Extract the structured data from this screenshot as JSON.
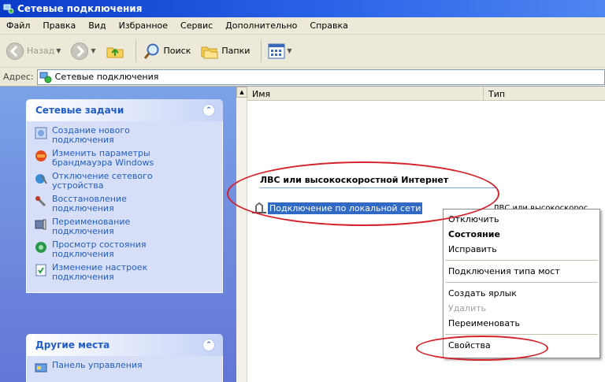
{
  "window": {
    "title": "Сетевые подключения"
  },
  "menu": [
    "Файл",
    "Правка",
    "Вид",
    "Избранное",
    "Сервис",
    "Дополнительно",
    "Справка"
  ],
  "toolbar": {
    "back": "Назад",
    "search": "Поиск",
    "folders": "Папки"
  },
  "address": {
    "label": "Адрес:",
    "value": "Сетевые подключения"
  },
  "network_tasks": {
    "title": "Сетевые задачи",
    "items": [
      "Создание нового подключения",
      "Изменить параметры брандмауэра Windows",
      "Отключение сетевого устройства",
      "Восстановление подключения",
      "Переименование подключения",
      "Просмотр состояния подключения",
      "Изменение настроек подключения"
    ]
  },
  "other_places": {
    "title": "Другие места",
    "items": [
      "Панель управления"
    ]
  },
  "columns": {
    "name": "Имя",
    "type": "Тип"
  },
  "group": {
    "title": "ЛВС или высокоскоростной Интернет"
  },
  "connection": {
    "name": "Подключение по локальной сети",
    "type": "ЛВС или высокоскорос"
  },
  "context_menu": {
    "disconnect": "Отключить",
    "status": "Состояние",
    "repair": "Исправить",
    "bridge": "Подключения типа мост",
    "shortcut": "Создать ярлык",
    "delete": "Удалить",
    "rename": "Переименовать",
    "properties": "Свойства"
  },
  "colors": {
    "highlight": "#316ac5",
    "annotation": "#d6202a",
    "taskpane": "#6375d6"
  }
}
